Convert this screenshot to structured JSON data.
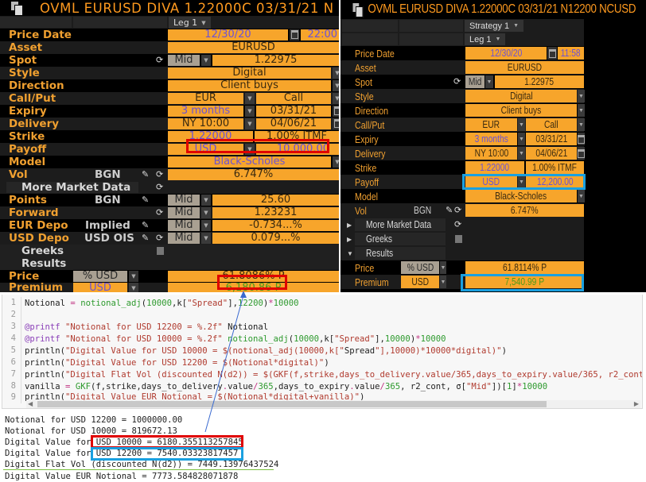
{
  "left_panel": {
    "title": "OVML EURUSD DIVA 1.22000C 03/31/21 N",
    "leg_tab": "Leg 1",
    "rows": {
      "price_date": {
        "label": "Price Date",
        "date": "12/30/20",
        "time": "22:00"
      },
      "asset": {
        "label": "Asset",
        "value": "EURUSD"
      },
      "spot": {
        "label": "Spot",
        "side": "Mid",
        "value": "1.22975"
      },
      "style": {
        "label": "Style",
        "value": "Digital"
      },
      "direction": {
        "label": "Direction",
        "value": "Client buys"
      },
      "call_put": {
        "label": "Call/Put",
        "ccy": "EUR",
        "value": "Call"
      },
      "expiry": {
        "label": "Expiry",
        "tenor": "3 months",
        "date": "03/31/21"
      },
      "delivery": {
        "label": "Delivery",
        "cut": "NY 10:00",
        "date": "04/06/21"
      },
      "strike": {
        "label": "Strike",
        "value": "1.22000",
        "moneyness": "1.00% ITMF"
      },
      "payoff": {
        "label": "Payoff",
        "ccy": "USD",
        "amount": "10,000.00"
      },
      "model": {
        "label": "Model",
        "value": "Black-Scholes"
      },
      "vol": {
        "label": "Vol",
        "source": "BGN",
        "value": "6.747%"
      },
      "more_market_data": {
        "label": "More Market Data"
      },
      "points": {
        "label": "Points",
        "source": "BGN",
        "side": "Mid",
        "value": "25.60"
      },
      "forward": {
        "label": "Forward",
        "side": "Mid",
        "value": "1.23231"
      },
      "eur_depo": {
        "label": "EUR Depo",
        "source": "Implied",
        "side": "Mid",
        "value": "-0.734...%"
      },
      "usd_depo": {
        "label": "USD Depo",
        "source": "USD OIS",
        "side": "Mid",
        "value": "0.079...%"
      },
      "greeks": {
        "label": "Greeks"
      },
      "results": {
        "label": "Results"
      },
      "price": {
        "label": "Price",
        "unit": "% USD",
        "value": "61.8086% P"
      },
      "premium": {
        "label": "Premium",
        "ccy": "USD",
        "value": "6,180.86 P"
      }
    }
  },
  "right_panel": {
    "title": "OVML EURUSD DIVA 1.22000C 03/31/21 N12200 NCUSD",
    "strategy_tab": "Strategy 1",
    "leg_tab": "Leg 1",
    "rows": {
      "price_date": {
        "label": "Price Date",
        "date": "12/30/20",
        "time": "11:58"
      },
      "asset": {
        "label": "Asset",
        "value": "EURUSD"
      },
      "spot": {
        "label": "Spot",
        "side": "Mid",
        "value": "1.22975"
      },
      "style": {
        "label": "Style",
        "value": "Digital"
      },
      "direction": {
        "label": "Direction",
        "value": "Client buys"
      },
      "call_put": {
        "label": "Call/Put",
        "ccy": "EUR",
        "value": "Call"
      },
      "expiry": {
        "label": "Expiry",
        "tenor": "3 months",
        "date": "03/31/21"
      },
      "delivery": {
        "label": "Delivery",
        "cut": "NY 10:00",
        "date": "04/06/21"
      },
      "strike": {
        "label": "Strike",
        "value": "1.22000",
        "moneyness": "1.00% ITMF"
      },
      "payoff": {
        "label": "Payoff",
        "ccy": "USD",
        "amount": "12,200.00"
      },
      "model": {
        "label": "Model",
        "value": "Black-Scholes"
      },
      "vol": {
        "label": "Vol",
        "source": "BGN",
        "value": "6.747%"
      },
      "more_market_data": {
        "label": "More Market Data"
      },
      "greeks": {
        "label": "Greeks"
      },
      "results": {
        "label": "Results"
      },
      "price": {
        "label": "Price",
        "unit": "% USD",
        "value": "61.8114% P"
      },
      "premium": {
        "label": "Premium",
        "ccy": "USD",
        "value": "7,540.99 P"
      }
    }
  },
  "code": {
    "line_numbers": [
      "1",
      "2",
      "3",
      "4",
      "5",
      "6",
      "7",
      "8",
      "9"
    ],
    "lines": [
      "Notional = notional_adj(10000,k[\"Spread\"],12200)*10000",
      "",
      "@printf \"Notional for USD 12200 = %.2f\" Notional",
      "@printf \"Notional for USD 10000 = %.2f\" notional_adj(10000,k[\"Spread\"],10000)*10000",
      "println(\"Digital Value for USD 10000 = $(notional_adj(10000,k[\"Spread\"],10000)*10000*digital)\")",
      "println(\"Digital Value for USD 12200 = $(Notional*digital)\")",
      "println(\"Digital Flat Vol (discounted N(d2)) = $(GKF(f,strike,days_to_delivery.value/365,days_to_expiry.value/365, r2_cont, ",
      "vanilla = GKF(f,strike,days_to_delivery.value/365,days_to_expiry.value/365, r2_cont, σ[\"Mid\"])[1]*10000",
      "println(\"Digital Value EUR Notional = $(Notional*digital+vanilla)\")"
    ]
  },
  "output": {
    "lines": [
      "Notional for USD 12200 = 1000000.00",
      "Notional for USD 10000 = 819672.13",
      "Digital Value for USD 10000 = 6180.355113257845",
      "Digital Value for USD 12200 = 7540.03323817457",
      "Digital Flat Vol (discounted N(d2)) = 7449.13976437524",
      "Digital Value EUR Notional = 7773.584828071878"
    ]
  },
  "colors": {
    "bloomberg_orange": "#f7a52b",
    "label_orange": "#f0a030",
    "highlight_red": "#e00000",
    "highlight_blue": "#1aa0e0",
    "value_blue": "#6b52d6",
    "value_green": "#4e9a1a"
  }
}
